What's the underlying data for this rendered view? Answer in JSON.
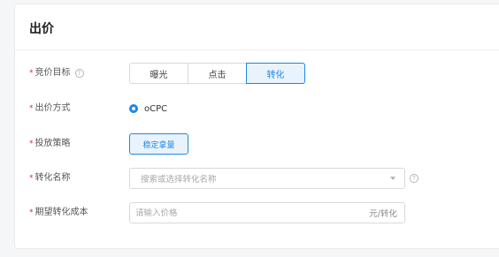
{
  "section": {
    "title": "出价"
  },
  "bid_goal": {
    "label": "竞价目标",
    "help_icon": "question-circle-icon",
    "options": [
      "曝光",
      "点击",
      "转化"
    ],
    "selected": "转化"
  },
  "bid_method": {
    "label": "出价方式",
    "option": "oCPC",
    "checked": true
  },
  "strategy": {
    "label": "投放策略",
    "value": "稳定拿量"
  },
  "conversion_name": {
    "label": "转化名称",
    "placeholder": "搜索或选择转化名称",
    "dropdown_icon": "caret-down-icon",
    "help_icon": "question-circle-icon"
  },
  "target_cost": {
    "label": "期望转化成本",
    "placeholder": "请输入价格",
    "suffix": "元/转化"
  },
  "colors": {
    "accent": "#1e88e5",
    "required": "#f5222d",
    "active_bg": "#e9f3fd"
  }
}
